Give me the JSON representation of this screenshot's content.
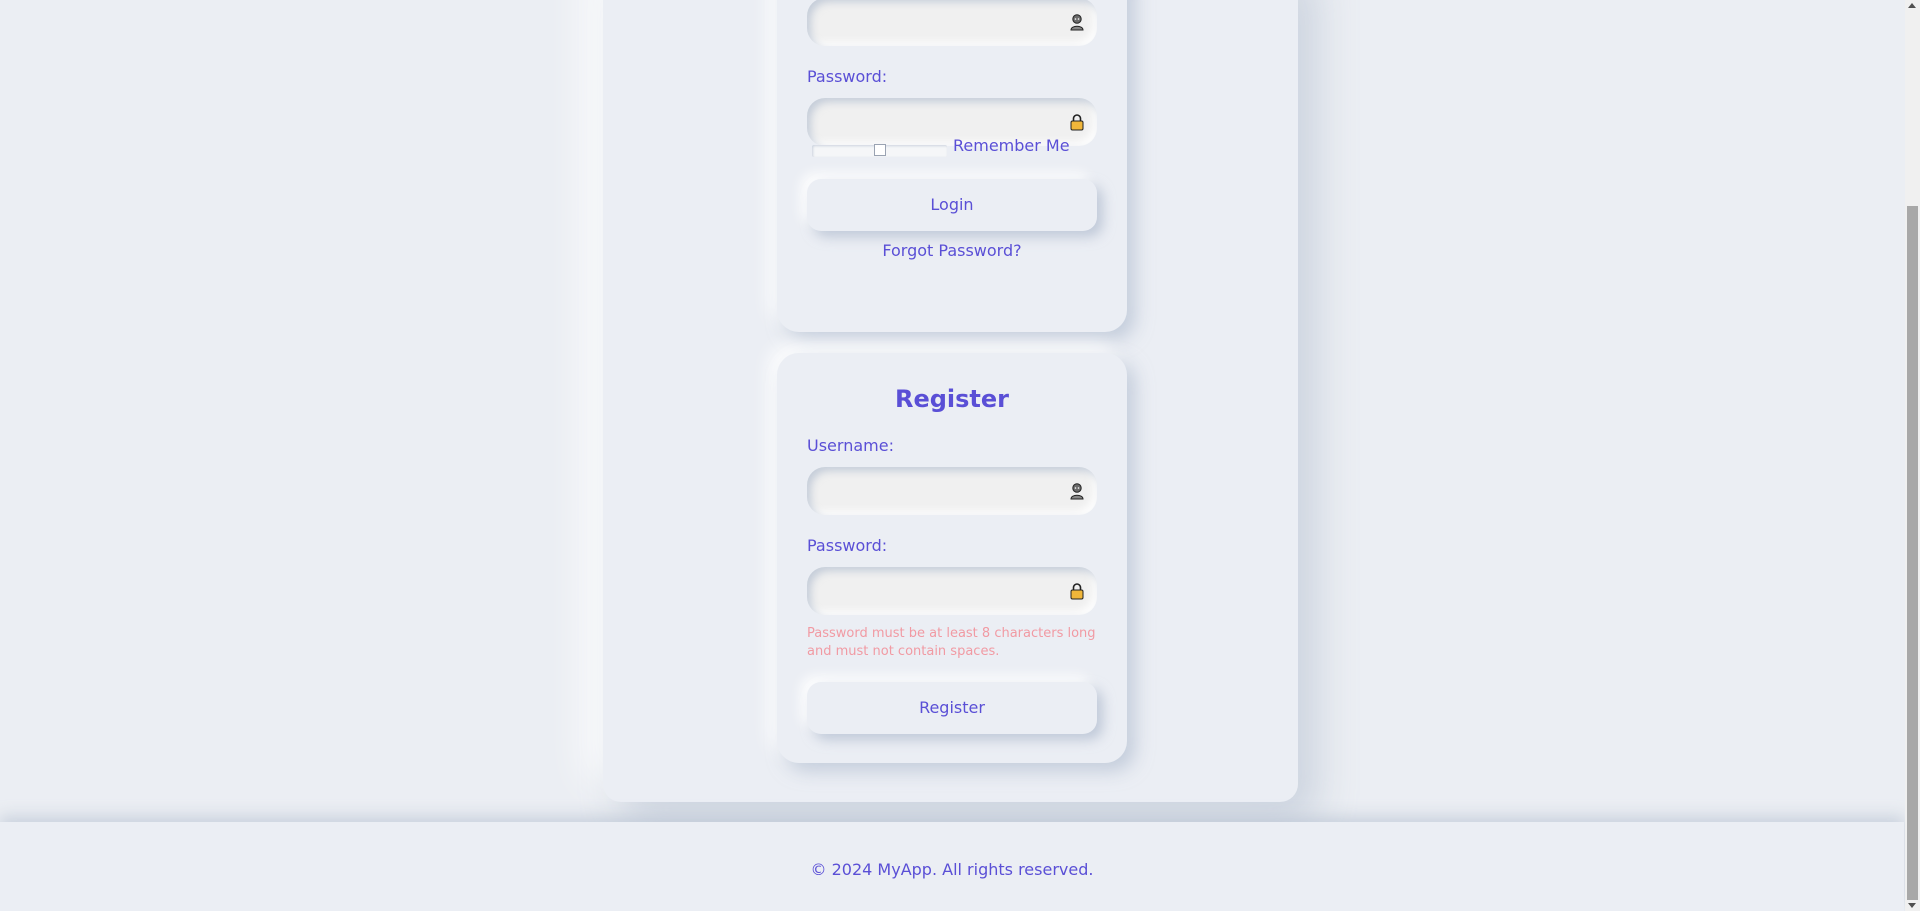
{
  "login": {
    "password_label": "Password:",
    "remember_label": "Remember Me",
    "remember_level": 0.5,
    "login_button": "Login",
    "forgot_link": "Forgot Password?"
  },
  "register": {
    "title": "Register",
    "username_label": "Username:",
    "password_label": "Password:",
    "password_hint": "Password must be at least 8 characters long and must not contain spaces.",
    "register_button": "Register"
  },
  "footer": {
    "text": "© 2024 MyApp. All rights reserved."
  },
  "icons": {
    "user": "user-icon",
    "lock": "lock-icon"
  },
  "colors": {
    "accent": "#5a4fd6",
    "hint": "#f19aa3",
    "lock": "#f0b63a",
    "background": "#ebeef4"
  }
}
